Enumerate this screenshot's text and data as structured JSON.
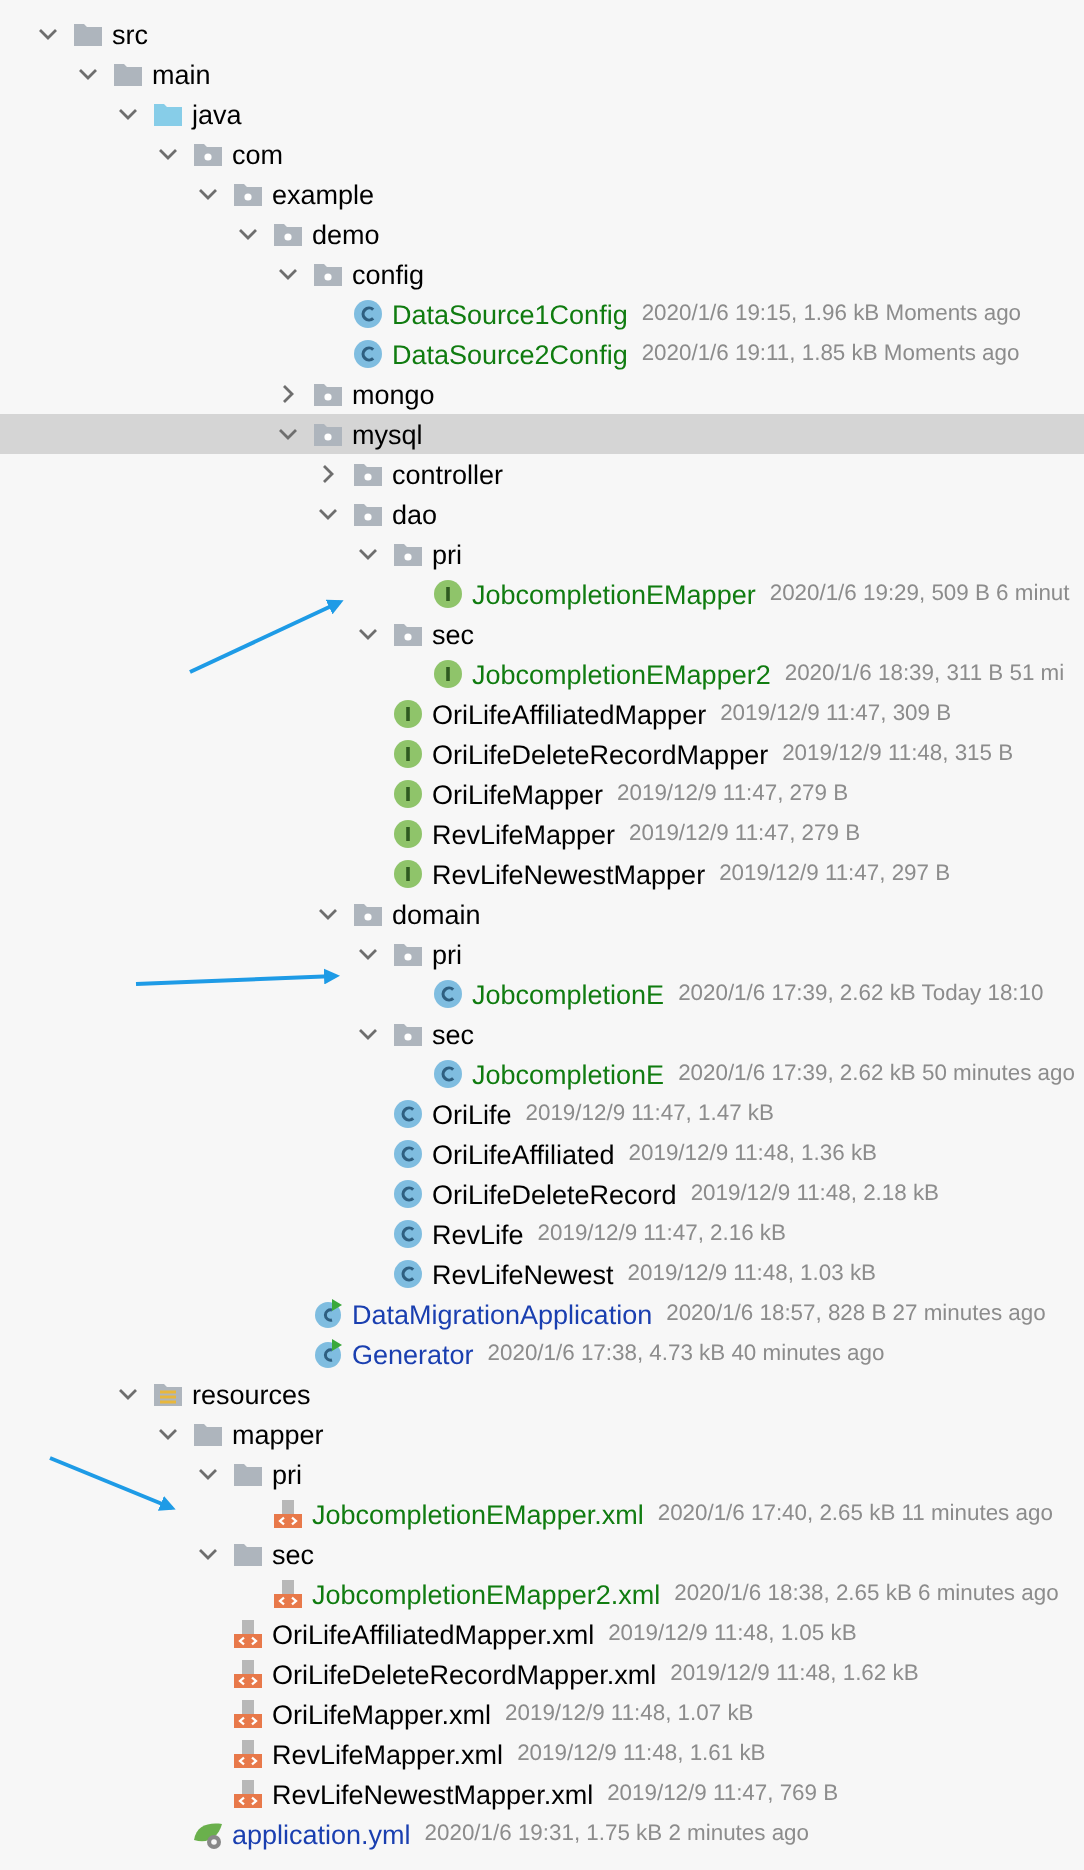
{
  "tree": [
    {
      "kind": "folder",
      "name": "src",
      "expanded": true,
      "selected": false,
      "children": [
        {
          "kind": "folder",
          "name": "main",
          "expanded": true,
          "selected": false,
          "children": [
            {
              "kind": "source-folder",
              "name": "java",
              "expanded": true,
              "selected": false,
              "children": [
                {
                  "kind": "package",
                  "name": "com",
                  "expanded": true,
                  "selected": false,
                  "children": [
                    {
                      "kind": "package",
                      "name": "example",
                      "expanded": true,
                      "selected": false,
                      "children": [
                        {
                          "kind": "package",
                          "name": "demo",
                          "expanded": true,
                          "selected": false,
                          "children": [
                            {
                              "kind": "package",
                              "name": "config",
                              "expanded": true,
                              "selected": false,
                              "children": [
                                {
                                  "kind": "class",
                                  "name": "DataSource1Config",
                                  "added": true,
                                  "modified": false,
                                  "meta": "2020/1/6 19:15, 1.96 kB Moments ago",
                                  "selected": false
                                },
                                {
                                  "kind": "class",
                                  "name": "DataSource2Config",
                                  "added": true,
                                  "modified": false,
                                  "meta": "2020/1/6 19:11, 1.85 kB Moments ago",
                                  "selected": false
                                }
                              ]
                            },
                            {
                              "kind": "package",
                              "name": "mongo",
                              "expanded": false,
                              "selected": false
                            },
                            {
                              "kind": "package",
                              "name": "mysql",
                              "expanded": true,
                              "selected": true,
                              "children": [
                                {
                                  "kind": "package",
                                  "name": "controller",
                                  "expanded": false,
                                  "selected": false
                                },
                                {
                                  "kind": "package",
                                  "name": "dao",
                                  "expanded": true,
                                  "selected": false,
                                  "children": [
                                    {
                                      "kind": "package",
                                      "name": "pri",
                                      "expanded": true,
                                      "selected": false,
                                      "children": [
                                        {
                                          "kind": "interface",
                                          "name": "JobcompletionEMapper",
                                          "added": true,
                                          "modified": false,
                                          "meta": "2020/1/6 19:29, 509 B 6 minut",
                                          "selected": false
                                        }
                                      ]
                                    },
                                    {
                                      "kind": "package",
                                      "name": "sec",
                                      "expanded": true,
                                      "selected": false,
                                      "children": [
                                        {
                                          "kind": "interface",
                                          "name": "JobcompletionEMapper2",
                                          "added": true,
                                          "modified": false,
                                          "meta": "2020/1/6 18:39, 311 B 51 mi",
                                          "selected": false
                                        }
                                      ]
                                    },
                                    {
                                      "kind": "interface",
                                      "name": "OriLifeAffiliatedMapper",
                                      "added": false,
                                      "modified": false,
                                      "meta": "2019/12/9 11:47, 309 B",
                                      "selected": false
                                    },
                                    {
                                      "kind": "interface",
                                      "name": "OriLifeDeleteRecordMapper",
                                      "added": false,
                                      "modified": false,
                                      "meta": "2019/12/9 11:48, 315 B",
                                      "selected": false
                                    },
                                    {
                                      "kind": "interface",
                                      "name": "OriLifeMapper",
                                      "added": false,
                                      "modified": false,
                                      "meta": "2019/12/9 11:47, 279 B",
                                      "selected": false
                                    },
                                    {
                                      "kind": "interface",
                                      "name": "RevLifeMapper",
                                      "added": false,
                                      "modified": false,
                                      "meta": "2019/12/9 11:47, 279 B",
                                      "selected": false
                                    },
                                    {
                                      "kind": "interface",
                                      "name": "RevLifeNewestMapper",
                                      "added": false,
                                      "modified": false,
                                      "meta": "2019/12/9 11:47, 297 B",
                                      "selected": false
                                    }
                                  ]
                                },
                                {
                                  "kind": "package",
                                  "name": "domain",
                                  "expanded": true,
                                  "selected": false,
                                  "children": [
                                    {
                                      "kind": "package",
                                      "name": "pri",
                                      "expanded": true,
                                      "selected": false,
                                      "children": [
                                        {
                                          "kind": "class",
                                          "name": "JobcompletionE",
                                          "added": true,
                                          "modified": false,
                                          "meta": "2020/1/6 17:39, 2.62 kB Today 18:10",
                                          "selected": false
                                        }
                                      ]
                                    },
                                    {
                                      "kind": "package",
                                      "name": "sec",
                                      "expanded": true,
                                      "selected": false,
                                      "children": [
                                        {
                                          "kind": "class",
                                          "name": "JobcompletionE",
                                          "added": true,
                                          "modified": false,
                                          "meta": "2020/1/6 17:39, 2.62 kB 50 minutes ago",
                                          "selected": false
                                        }
                                      ]
                                    },
                                    {
                                      "kind": "class",
                                      "name": "OriLife",
                                      "added": false,
                                      "modified": false,
                                      "meta": "2019/12/9 11:47, 1.47 kB",
                                      "selected": false
                                    },
                                    {
                                      "kind": "class",
                                      "name": "OriLifeAffiliated",
                                      "added": false,
                                      "modified": false,
                                      "meta": "2019/12/9 11:48, 1.36 kB",
                                      "selected": false
                                    },
                                    {
                                      "kind": "class",
                                      "name": "OriLifeDeleteRecord",
                                      "added": false,
                                      "modified": false,
                                      "meta": "2019/12/9 11:48, 2.18 kB",
                                      "selected": false
                                    },
                                    {
                                      "kind": "class",
                                      "name": "RevLife",
                                      "added": false,
                                      "modified": false,
                                      "meta": "2019/12/9 11:47, 2.16 kB",
                                      "selected": false
                                    },
                                    {
                                      "kind": "class",
                                      "name": "RevLifeNewest",
                                      "added": false,
                                      "modified": false,
                                      "meta": "2019/12/9 11:48, 1.03 kB",
                                      "selected": false
                                    }
                                  ]
                                }
                              ]
                            },
                            {
                              "kind": "app-class",
                              "name": "DataMigrationApplication",
                              "added": false,
                              "modified": true,
                              "meta": "2020/1/6 18:57, 828 B 27 minutes ago",
                              "selected": false
                            },
                            {
                              "kind": "app-class",
                              "name": "Generator",
                              "added": false,
                              "modified": true,
                              "meta": "2020/1/6 17:38, 4.73 kB 40 minutes ago",
                              "selected": false
                            }
                          ]
                        }
                      ]
                    }
                  ]
                }
              ]
            },
            {
              "kind": "resources-folder",
              "name": "resources",
              "expanded": true,
              "selected": false,
              "children": [
                {
                  "kind": "folder",
                  "name": "mapper",
                  "expanded": true,
                  "selected": false,
                  "children": [
                    {
                      "kind": "folder",
                      "name": "pri",
                      "expanded": true,
                      "selected": false,
                      "children": [
                        {
                          "kind": "xml",
                          "name": "JobcompletionEMapper.xml",
                          "added": true,
                          "modified": false,
                          "meta": "2020/1/6 17:40, 2.65 kB 11 minutes ago",
                          "selected": false
                        }
                      ]
                    },
                    {
                      "kind": "folder",
                      "name": "sec",
                      "expanded": true,
                      "selected": false,
                      "children": [
                        {
                          "kind": "xml",
                          "name": "JobcompletionEMapper2.xml",
                          "added": true,
                          "modified": false,
                          "meta": "2020/1/6 18:38, 2.65 kB 6 minutes ago",
                          "selected": false
                        }
                      ]
                    },
                    {
                      "kind": "xml",
                      "name": "OriLifeAffiliatedMapper.xml",
                      "added": false,
                      "modified": false,
                      "meta": "2019/12/9 11:48, 1.05 kB",
                      "selected": false
                    },
                    {
                      "kind": "xml",
                      "name": "OriLifeDeleteRecordMapper.xml",
                      "added": false,
                      "modified": false,
                      "meta": "2019/12/9 11:48, 1.62 kB",
                      "selected": false
                    },
                    {
                      "kind": "xml",
                      "name": "OriLifeMapper.xml",
                      "added": false,
                      "modified": false,
                      "meta": "2019/12/9 11:48, 1.07 kB",
                      "selected": false
                    },
                    {
                      "kind": "xml",
                      "name": "RevLifeMapper.xml",
                      "added": false,
                      "modified": false,
                      "meta": "2019/12/9 11:48, 1.61 kB",
                      "selected": false
                    },
                    {
                      "kind": "xml",
                      "name": "RevLifeNewestMapper.xml",
                      "added": false,
                      "modified": false,
                      "meta": "2019/12/9 11:47, 769 B",
                      "selected": false
                    }
                  ]
                },
                {
                  "kind": "yml",
                  "name": "application.yml",
                  "added": false,
                  "modified": true,
                  "meta": "2020/1/6 19:31, 1.75 kB 2 minutes ago",
                  "selected": false
                }
              ]
            }
          ]
        }
      ]
    }
  ]
}
